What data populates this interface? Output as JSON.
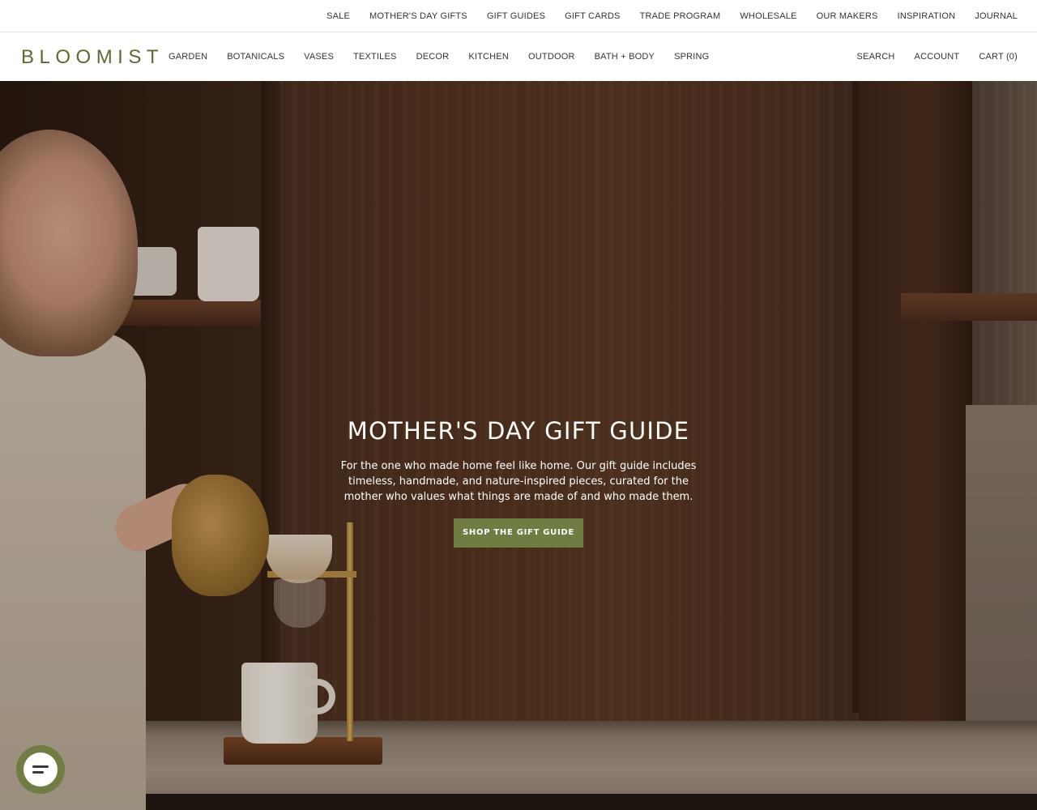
{
  "utility_nav": {
    "items": [
      {
        "label": "SALE"
      },
      {
        "label": "MOTHER'S DAY GIFTS"
      },
      {
        "label": "GIFT GUIDES"
      },
      {
        "label": "GIFT CARDS"
      },
      {
        "label": "TRADE PROGRAM"
      },
      {
        "label": "WHOLESALE"
      },
      {
        "label": "OUR MAKERS"
      },
      {
        "label": "INSPIRATION"
      },
      {
        "label": "JOURNAL"
      }
    ]
  },
  "header": {
    "logo": "BLOOMIST",
    "logo_color": "#5a6b33",
    "main_nav": [
      {
        "label": "GARDEN"
      },
      {
        "label": "BOTANICALS"
      },
      {
        "label": "VASES"
      },
      {
        "label": "TEXTILES"
      },
      {
        "label": "DECOR"
      },
      {
        "label": "KITCHEN"
      },
      {
        "label": "OUTDOOR"
      },
      {
        "label": "BATH + BODY"
      },
      {
        "label": "SPRING"
      }
    ],
    "utility": {
      "search": "SEARCH",
      "account": "ACCOUNT",
      "cart": "CART (0)"
    }
  },
  "hero": {
    "title": "MOTHER'S DAY GIFT GUIDE",
    "description": "For the one who made home feel like home. Our gift guide includes timeless, handmade, and nature-inspired pieces, curated for the mother who values what things are made of and who made them.",
    "cta_label": "SHOP THE GIFT GUIDE",
    "cta_color": "#6f7d43"
  },
  "chat": {
    "icon": "chat-bubble-icon",
    "color": "#6f7d43"
  }
}
